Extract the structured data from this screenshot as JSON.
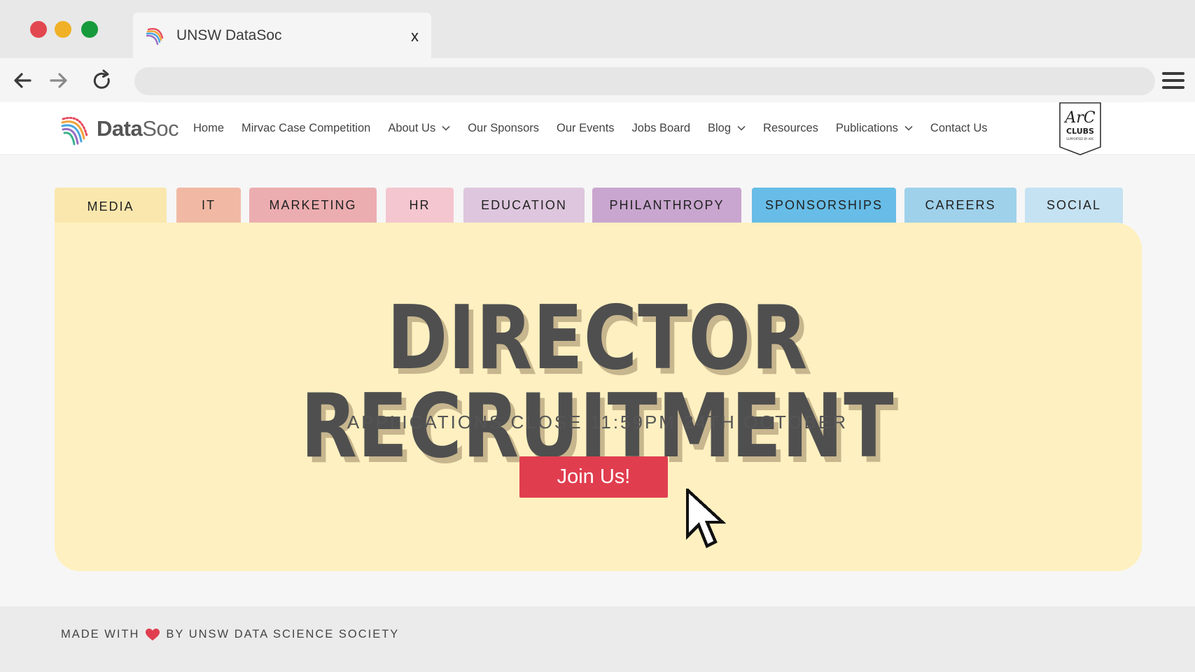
{
  "browser": {
    "tab_title": "UNSW DataSoc",
    "tab_close": "x",
    "url": "",
    "traffic_colors": [
      "#e2474f",
      "#f0b126",
      "#179a3b"
    ]
  },
  "nav": {
    "logo_bold": "Data",
    "logo_rest": "Soc",
    "items": [
      {
        "label": "Home",
        "dropdown": false
      },
      {
        "label": "Mirvac Case Competition",
        "dropdown": false
      },
      {
        "label": "About Us",
        "dropdown": true
      },
      {
        "label": "Our Sponsors",
        "dropdown": false
      },
      {
        "label": "Our Events",
        "dropdown": false
      },
      {
        "label": "Jobs Board",
        "dropdown": false
      },
      {
        "label": "Blog",
        "dropdown": true
      },
      {
        "label": "Resources",
        "dropdown": false
      },
      {
        "label": "Publications",
        "dropdown": true
      },
      {
        "label": "Contact Us",
        "dropdown": false
      }
    ],
    "badge": {
      "line1": "ArC",
      "line2": "CLUBS",
      "line3": "SUPPORTED BY ARC"
    }
  },
  "hero": {
    "tabs": [
      {
        "label": "MEDIA",
        "color": "#fae7ad"
      },
      {
        "label": "IT",
        "color": "#f1b9a4"
      },
      {
        "label": "MARKETING",
        "color": "#ecadb0"
      },
      {
        "label": "HR",
        "color": "#f4c6cf"
      },
      {
        "label": "EDUCATION",
        "color": "#dec7de"
      },
      {
        "label": "PHILANTHROPY",
        "color": "#c9a6cf"
      },
      {
        "label": "SPONSORSHIPS",
        "color": "#67bde7"
      },
      {
        "label": "CAREERS",
        "color": "#9fd1eb"
      },
      {
        "label": "SOCIAL",
        "color": "#c5e2f2"
      }
    ],
    "headline": "DIRECTOR RECRUITMENT",
    "subheadline": "APPLICATIONS CLOSE 11:59PM 24TH OCTOBER",
    "cta": "Join Us!"
  },
  "footer": {
    "prefix": "MADE WITH",
    "suffix": "BY UNSW DATA SCIENCE SOCIETY"
  },
  "colors": {
    "accent": "#e03e4f",
    "card_bg": "#fef0c0",
    "headline": "#4f4f4f",
    "headline_shadow": "#c7b68e"
  }
}
